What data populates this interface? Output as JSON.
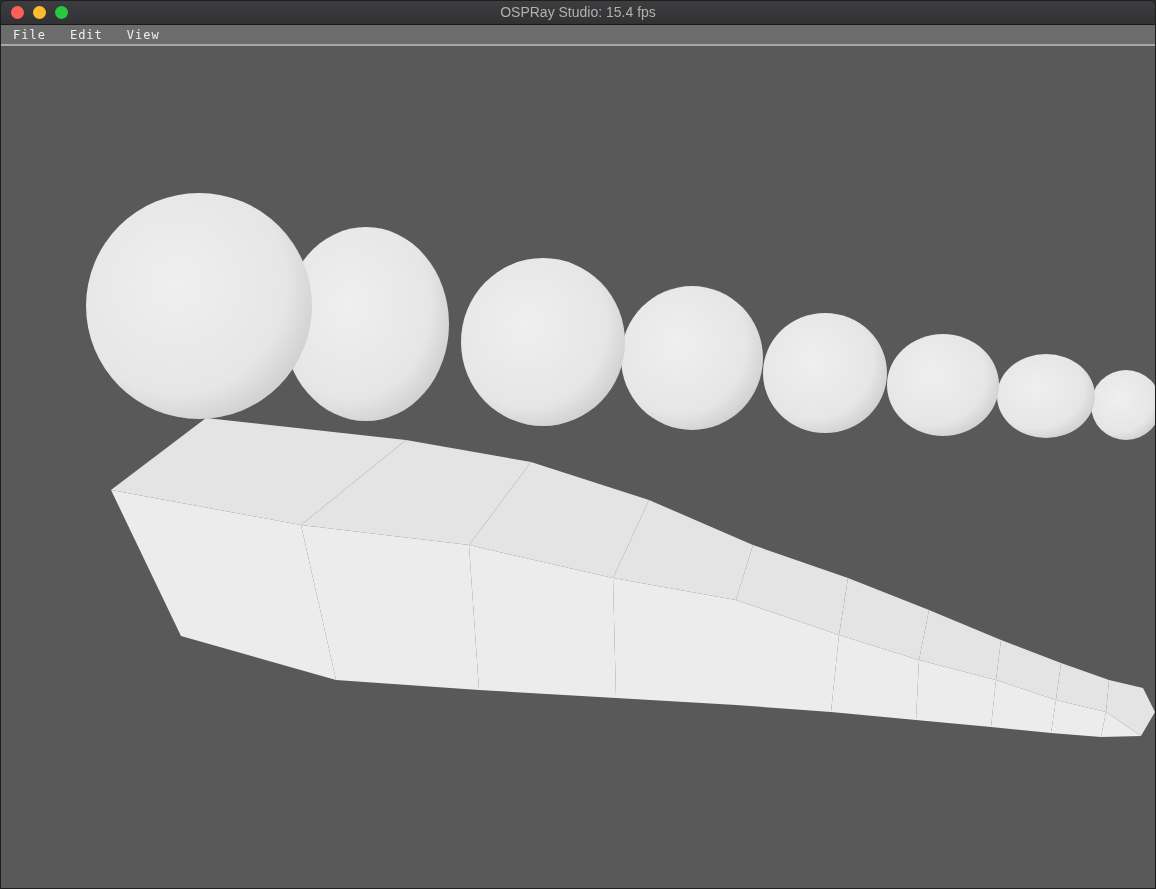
{
  "window": {
    "title": "OSPRay Studio: 15.4 fps"
  },
  "menu_bar": [
    {
      "label": "File"
    },
    {
      "label": "Edit"
    },
    {
      "label": "View"
    }
  ]
}
